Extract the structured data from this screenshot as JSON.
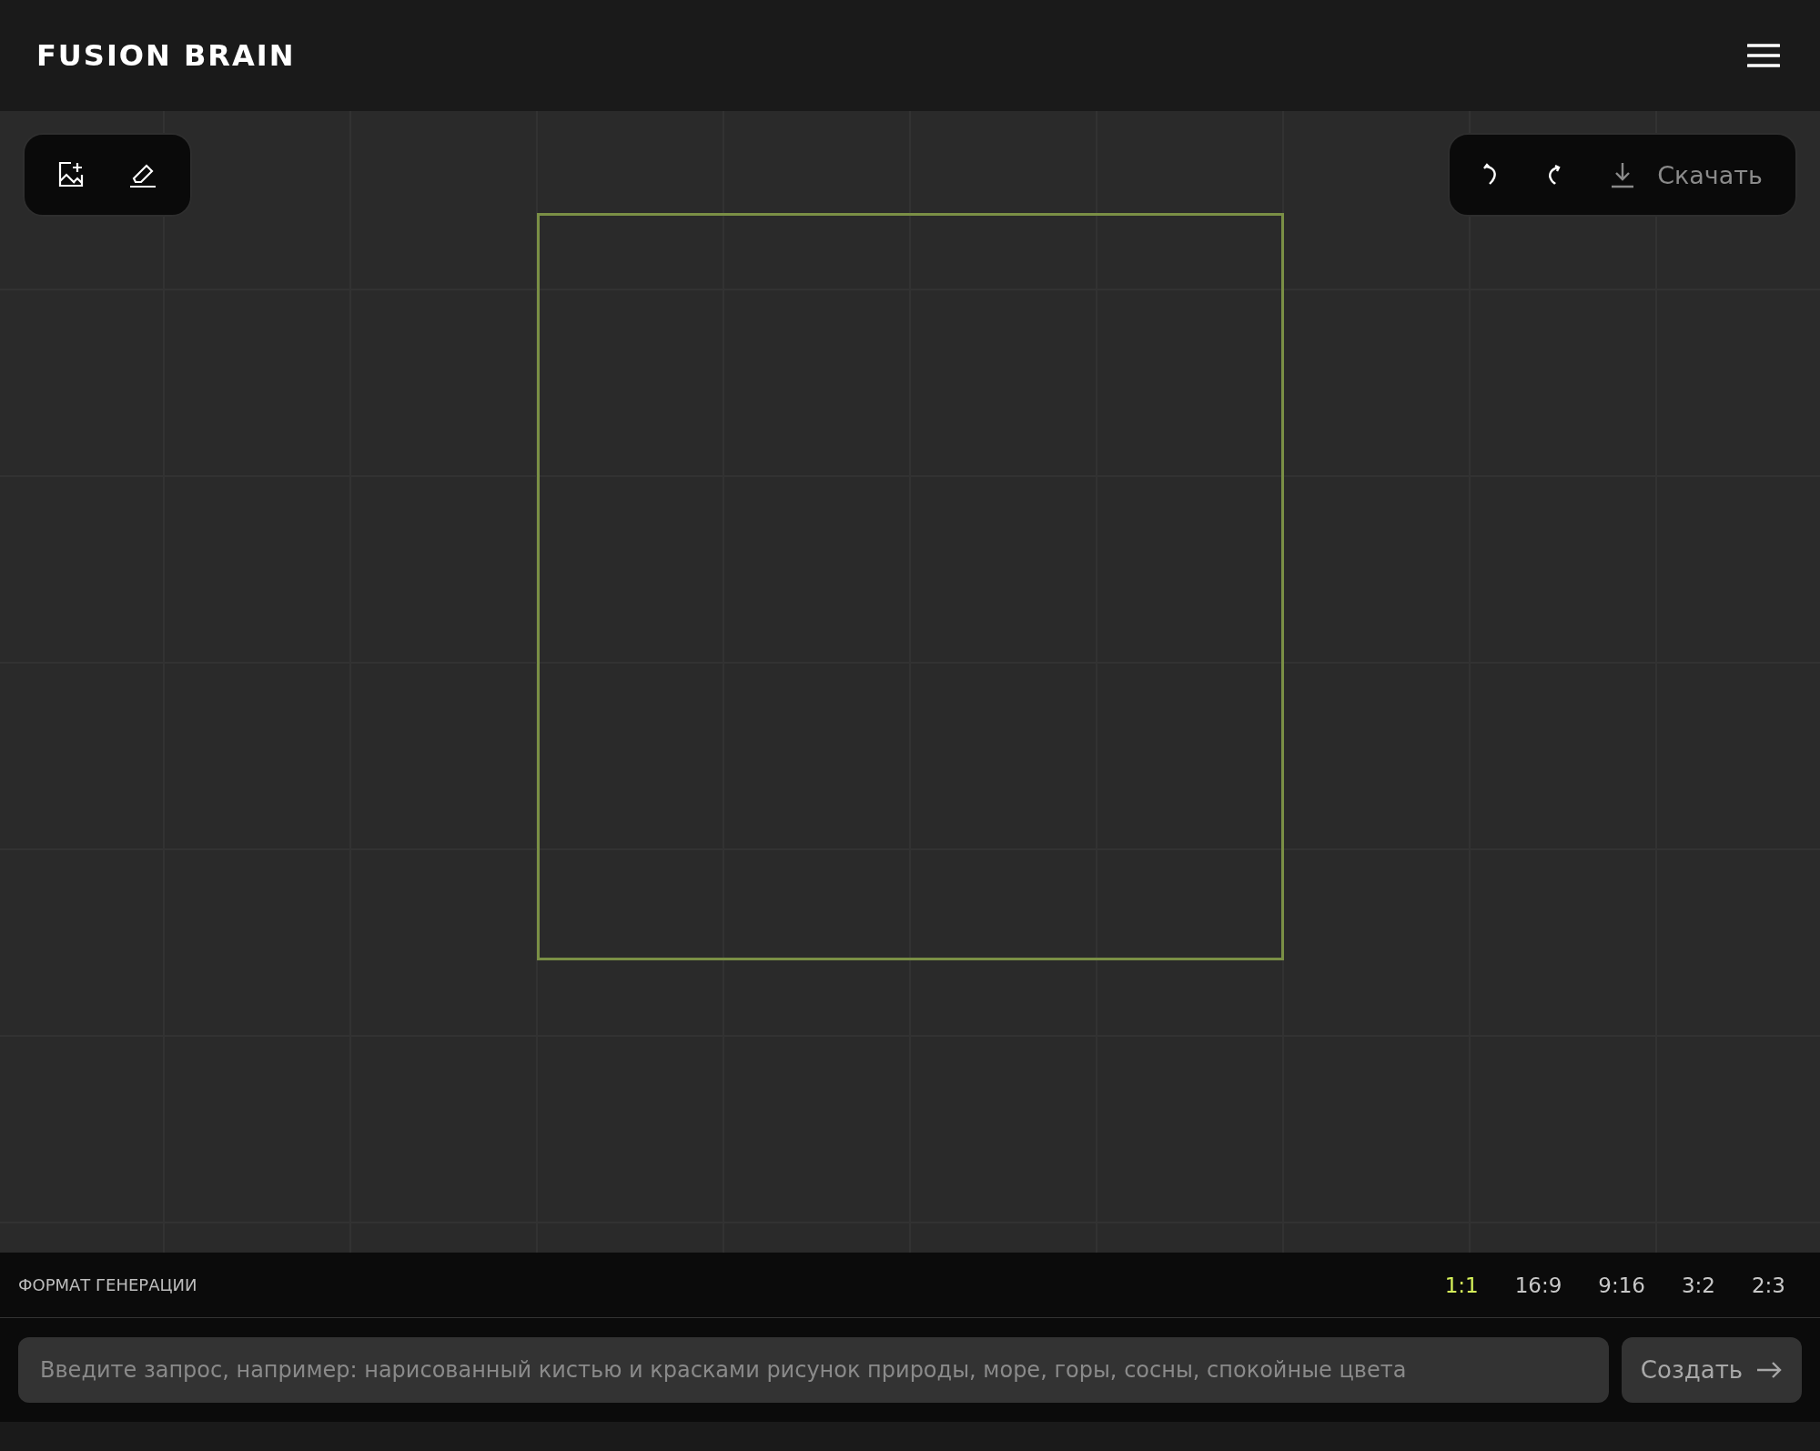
{
  "header": {
    "logo": "FUSION BRAIN"
  },
  "left_toolbar": [
    {
      "kind": "add-image",
      "disabled": false
    },
    {
      "kind": "eraser",
      "disabled": false
    }
  ],
  "right_toolbar": [
    {
      "kind": "undo",
      "disabled": false
    },
    {
      "kind": "redo",
      "disabled": false
    },
    {
      "kind": "download",
      "label": "Скачать",
      "disabled": true
    }
  ],
  "format": {
    "label": "ФОРМАТ ГЕНЕРАЦИИ",
    "options": [
      {
        "label": "1:1",
        "selected": true
      },
      {
        "label": "16:9",
        "selected": false
      },
      {
        "label": "9:16",
        "selected": false
      },
      {
        "label": "3:2",
        "selected": false
      },
      {
        "label": "2:3",
        "selected": false
      }
    ]
  },
  "prompt": {
    "placeholder": "Введите запрос, например: нарисованный кистью и красками рисунок природы, море, горы, сосны, спокойные цвета"
  },
  "create_button": {
    "label": "Создать"
  }
}
